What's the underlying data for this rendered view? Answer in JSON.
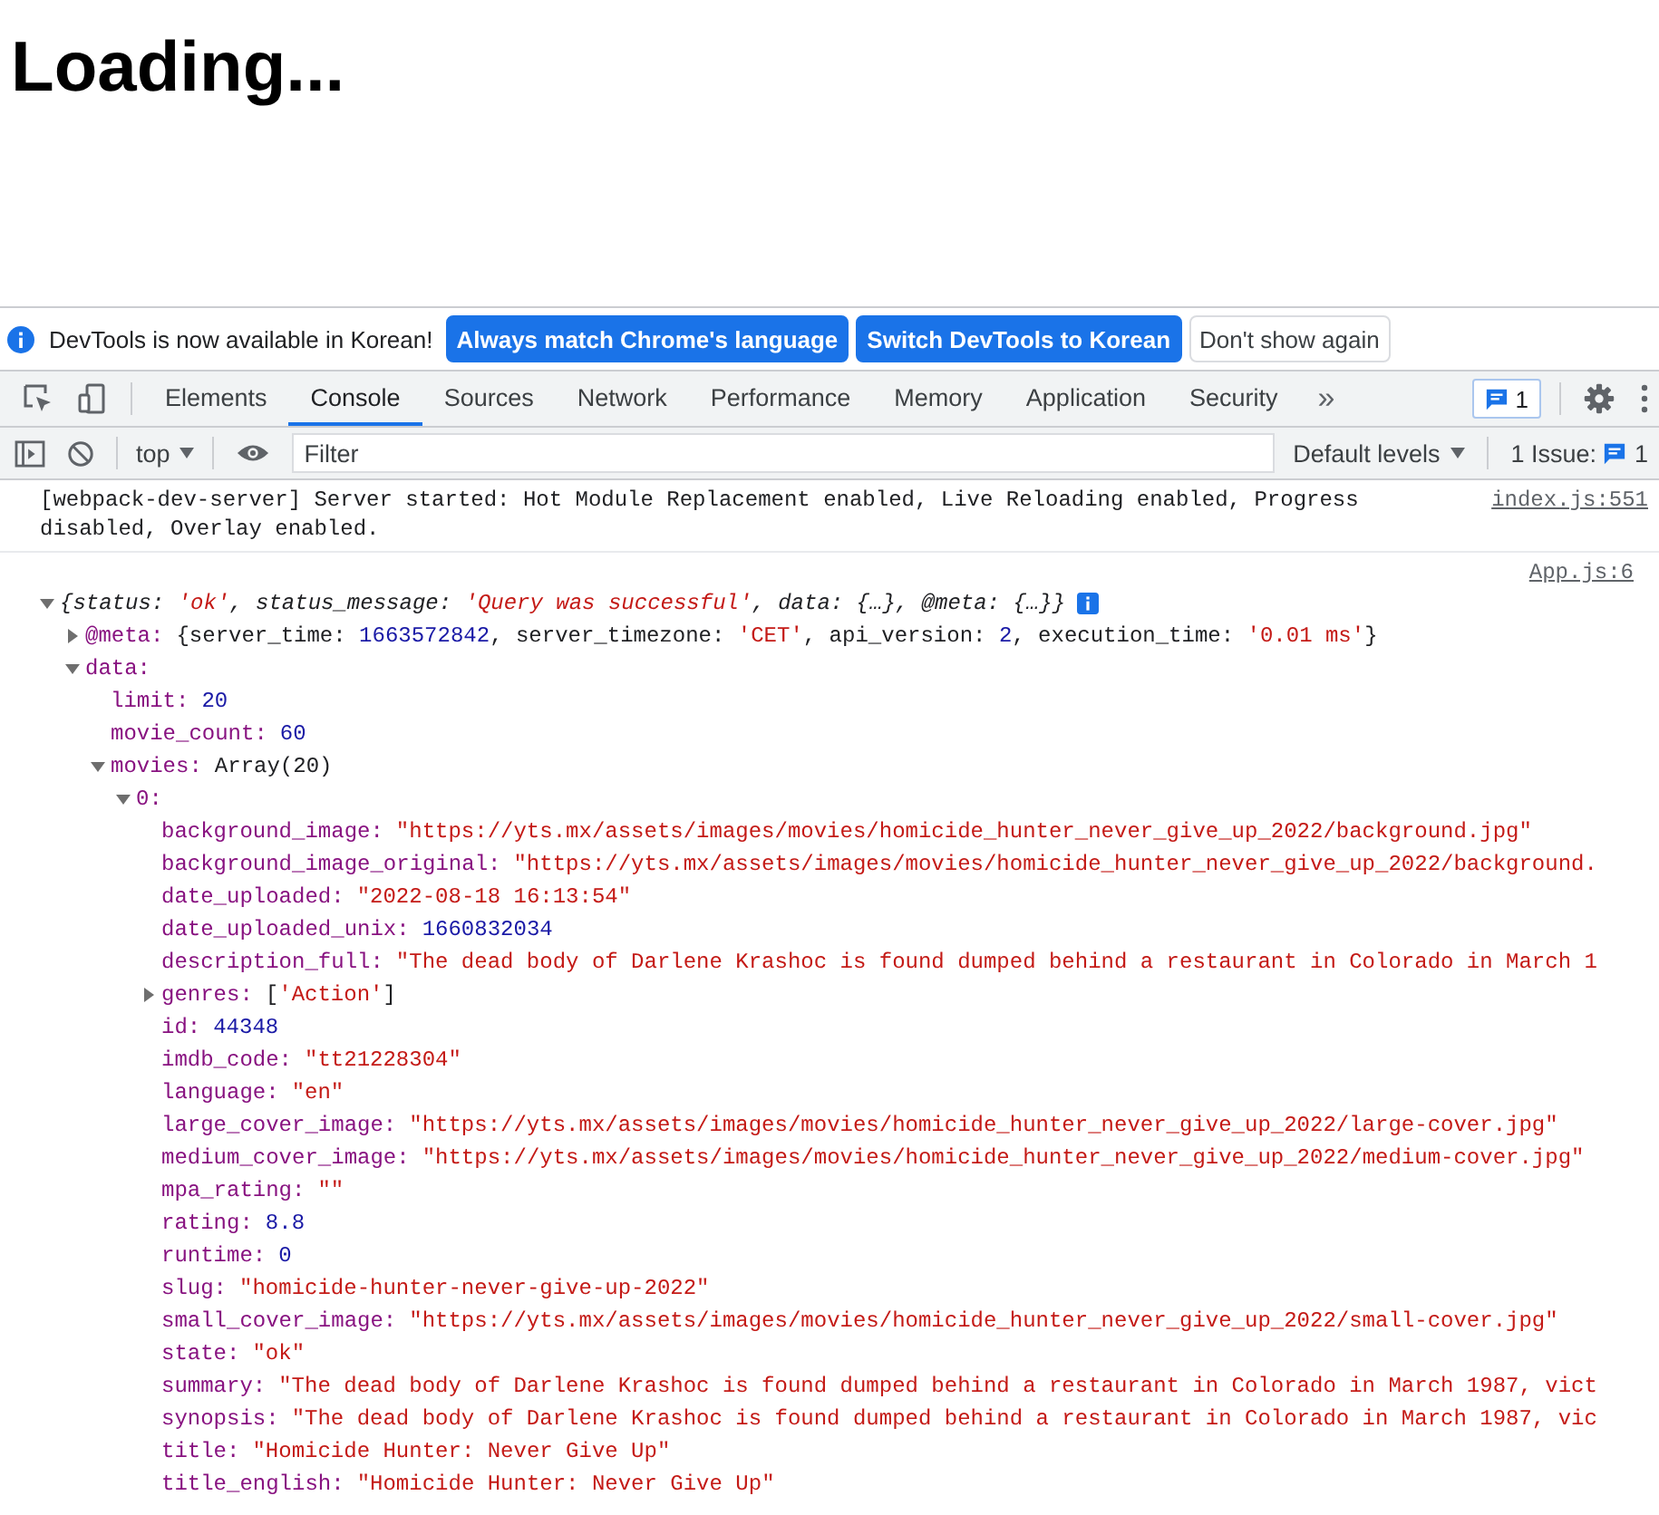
{
  "page": {
    "heading": "Loading..."
  },
  "infobar": {
    "message": "DevTools is now available in Korean!",
    "buttons": [
      {
        "label": "Always match Chrome's language",
        "kind": "primary"
      },
      {
        "label": "Switch DevTools to Korean",
        "kind": "primary"
      },
      {
        "label": "Don't show again",
        "kind": "secondary"
      }
    ]
  },
  "tabs": [
    {
      "label": "Elements",
      "selected": false
    },
    {
      "label": "Console",
      "selected": true
    },
    {
      "label": "Sources",
      "selected": false
    },
    {
      "label": "Network",
      "selected": false
    },
    {
      "label": "Performance",
      "selected": false
    },
    {
      "label": "Memory",
      "selected": false
    },
    {
      "label": "Application",
      "selected": false
    },
    {
      "label": "Security",
      "selected": false
    }
  ],
  "more_tabs": "»",
  "messages_badge": "1",
  "console_toolbar": {
    "context": "top",
    "filter_placeholder": "Filter",
    "levels": "Default levels",
    "issues_label": "1 Issue:",
    "issues_count": "1"
  },
  "messages": [
    {
      "text": "[webpack-dev-server] Server started: Hot Module Replacement enabled, Live Reloading enabled, Progress disabled, Overlay enabled.",
      "source": "index.js:551"
    }
  ],
  "log": {
    "source": "App.js:6",
    "tree": [
      {
        "expanded": true,
        "info_badge": true,
        "value": [
          {
            "text": "{status: ",
            "kind": "plain"
          },
          {
            "text": "'ok'",
            "kind": "string"
          },
          {
            "text": ", status_message: ",
            "kind": "plain"
          },
          {
            "text": "'Query was successful'",
            "kind": "string"
          },
          {
            "text": ", data: {…}, @meta: {…}}",
            "kind": "plain"
          }
        ],
        "children": [
          {
            "key": "@meta:",
            "expanded": false,
            "value": [
              {
                "text": "{server_time: ",
                "kind": "plain"
              },
              {
                "text": "1663572842",
                "kind": "number"
              },
              {
                "text": ", server_timezone: ",
                "kind": "plain"
              },
              {
                "text": "'CET'",
                "kind": "string"
              },
              {
                "text": ", api_version: ",
                "kind": "plain"
              },
              {
                "text": "2",
                "kind": "number"
              },
              {
                "text": ", execution_time: ",
                "kind": "plain"
              },
              {
                "text": "'0.01 ms'",
                "kind": "string"
              },
              {
                "text": "}",
                "kind": "plain"
              }
            ]
          },
          {
            "key": "data:",
            "expanded": true,
            "children": [
              {
                "key": "limit:",
                "value": [
                  {
                    "text": "20",
                    "kind": "number"
                  }
                ]
              },
              {
                "key": "movie_count:",
                "value": [
                  {
                    "text": "60",
                    "kind": "number"
                  }
                ]
              },
              {
                "key": "movies:",
                "expanded": true,
                "value": [
                  {
                    "text": "Array(20)",
                    "kind": "plain"
                  }
                ],
                "children": [
                  {
                    "key": "0:",
                    "expanded": true,
                    "children": [
                      {
                        "key": "background_image:",
                        "value": [
                          {
                            "text": "\"https://yts.mx/assets/images/movies/homicide_hunter_never_give_up_2022/background.jpg\"",
                            "kind": "string"
                          }
                        ]
                      },
                      {
                        "key": "background_image_original:",
                        "value": [
                          {
                            "text": "\"https://yts.mx/assets/images/movies/homicide_hunter_never_give_up_2022/background.",
                            "kind": "string"
                          }
                        ]
                      },
                      {
                        "key": "date_uploaded:",
                        "value": [
                          {
                            "text": "\"2022-08-18 16:13:54\"",
                            "kind": "string"
                          }
                        ]
                      },
                      {
                        "key": "date_uploaded_unix:",
                        "value": [
                          {
                            "text": "1660832034",
                            "kind": "number"
                          }
                        ]
                      },
                      {
                        "key": "description_full:",
                        "value": [
                          {
                            "text": "\"The dead body of Darlene Krashoc is found dumped behind a restaurant in Colorado in March 1",
                            "kind": "string"
                          }
                        ]
                      },
                      {
                        "key": "genres:",
                        "expanded": false,
                        "value": [
                          {
                            "text": "[",
                            "kind": "plain"
                          },
                          {
                            "text": "'Action'",
                            "kind": "string"
                          },
                          {
                            "text": "]",
                            "kind": "plain"
                          }
                        ]
                      },
                      {
                        "key": "id:",
                        "value": [
                          {
                            "text": "44348",
                            "kind": "number"
                          }
                        ]
                      },
                      {
                        "key": "imdb_code:",
                        "value": [
                          {
                            "text": "\"tt21228304\"",
                            "kind": "string"
                          }
                        ]
                      },
                      {
                        "key": "language:",
                        "value": [
                          {
                            "text": "\"en\"",
                            "kind": "string"
                          }
                        ]
                      },
                      {
                        "key": "large_cover_image:",
                        "value": [
                          {
                            "text": "\"https://yts.mx/assets/images/movies/homicide_hunter_never_give_up_2022/large-cover.jpg\"",
                            "kind": "string"
                          }
                        ]
                      },
                      {
                        "key": "medium_cover_image:",
                        "value": [
                          {
                            "text": "\"https://yts.mx/assets/images/movies/homicide_hunter_never_give_up_2022/medium-cover.jpg\"",
                            "kind": "string"
                          }
                        ]
                      },
                      {
                        "key": "mpa_rating:",
                        "value": [
                          {
                            "text": "\"\"",
                            "kind": "string"
                          }
                        ]
                      },
                      {
                        "key": "rating:",
                        "value": [
                          {
                            "text": "8.8",
                            "kind": "number"
                          }
                        ]
                      },
                      {
                        "key": "runtime:",
                        "value": [
                          {
                            "text": "0",
                            "kind": "number"
                          }
                        ]
                      },
                      {
                        "key": "slug:",
                        "value": [
                          {
                            "text": "\"homicide-hunter-never-give-up-2022\"",
                            "kind": "string"
                          }
                        ]
                      },
                      {
                        "key": "small_cover_image:",
                        "value": [
                          {
                            "text": "\"https://yts.mx/assets/images/movies/homicide_hunter_never_give_up_2022/small-cover.jpg\"",
                            "kind": "string"
                          }
                        ]
                      },
                      {
                        "key": "state:",
                        "value": [
                          {
                            "text": "\"ok\"",
                            "kind": "string"
                          }
                        ]
                      },
                      {
                        "key": "summary:",
                        "value": [
                          {
                            "text": "\"The dead body of Darlene Krashoc is found dumped behind a restaurant in Colorado in March 1987, vict",
                            "kind": "string"
                          }
                        ]
                      },
                      {
                        "key": "synopsis:",
                        "value": [
                          {
                            "text": "\"The dead body of Darlene Krashoc is found dumped behind a restaurant in Colorado in March 1987, vic",
                            "kind": "string"
                          }
                        ]
                      },
                      {
                        "key": "title:",
                        "value": [
                          {
                            "text": "\"Homicide Hunter: Never Give Up\"",
                            "kind": "string"
                          }
                        ]
                      },
                      {
                        "key": "title_english:",
                        "value": [
                          {
                            "text": "\"Homicide Hunter: Never Give Up\"",
                            "kind": "string"
                          }
                        ]
                      }
                    ]
                  }
                ]
              }
            ]
          }
        ]
      }
    ]
  }
}
